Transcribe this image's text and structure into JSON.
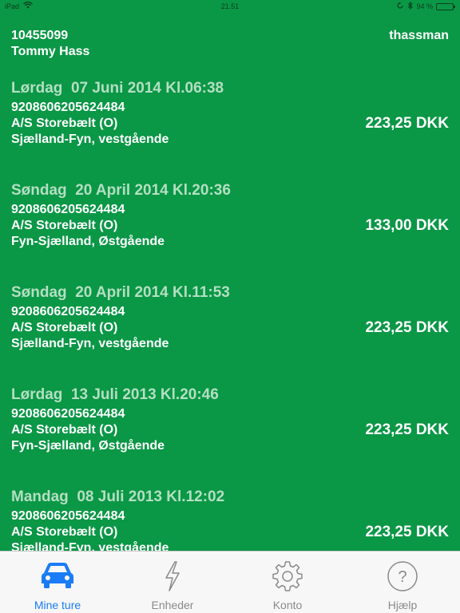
{
  "status_bar": {
    "carrier": "iPad",
    "time": "21.51",
    "battery": "94 %",
    "battery_level": 0.94
  },
  "header": {
    "account_number": "10455099",
    "account_name": "Tommy Hass",
    "username": "thassman"
  },
  "trips": [
    {
      "date": "Lørdag  07 Juni 2014 Kl.06:38",
      "card": "9208606205624484",
      "operator": "A/S Storebælt (O)",
      "route": "Sjælland-Fyn, vestgående",
      "amount": "223,25 DKK"
    },
    {
      "date": "Søndag  20 April 2014 Kl.20:36",
      "card": "9208606205624484",
      "operator": "A/S Storebælt (O)",
      "route": "Fyn-Sjælland, Østgående",
      "amount": "133,00 DKK"
    },
    {
      "date": "Søndag  20 April 2014 Kl.11:53",
      "card": "9208606205624484",
      "operator": "A/S Storebælt (O)",
      "route": "Sjælland-Fyn, vestgående",
      "amount": "223,25 DKK"
    },
    {
      "date": "Lørdag  13 Juli 2013 Kl.20:46",
      "card": "9208606205624484",
      "operator": "A/S Storebælt (O)",
      "route": "Fyn-Sjælland, Østgående",
      "amount": "223,25 DKK"
    },
    {
      "date": "Mandag  08 Juli 2013 Kl.12:02",
      "card": "9208606205624484",
      "operator": "A/S Storebælt (O)",
      "route": "Sjælland-Fyn, vestgående",
      "amount": "223,25 DKK"
    }
  ],
  "tabs": [
    {
      "label": "Mine ture",
      "icon": "car-icon",
      "active": true
    },
    {
      "label": "Enheder",
      "icon": "lightning-icon",
      "active": false
    },
    {
      "label": "Konto",
      "icon": "gear-icon",
      "active": false
    },
    {
      "label": "Hjælp",
      "icon": "question-icon",
      "active": false
    }
  ],
  "colors": {
    "background": "#0a9746",
    "date_text": "#b4dfc2",
    "tab_active": "#1a7cf6",
    "tab_inactive": "#8a8a8a"
  }
}
